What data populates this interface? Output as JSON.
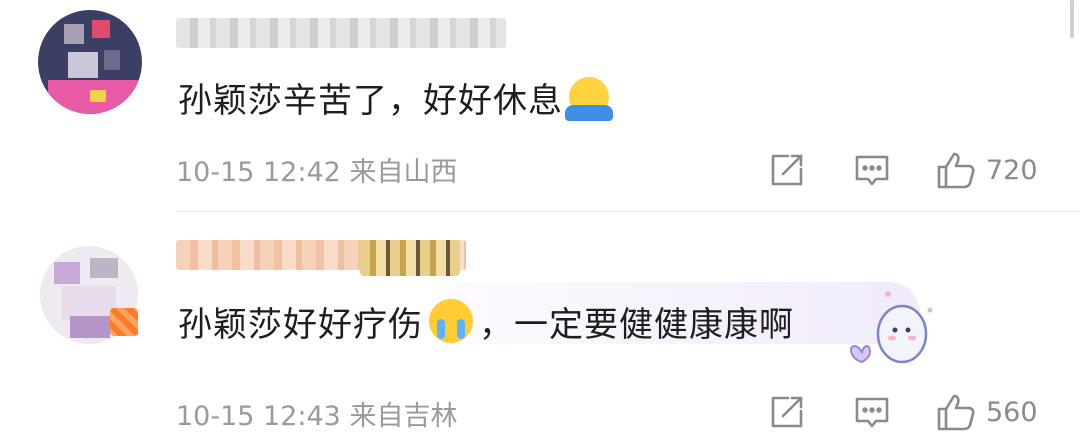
{
  "comments": [
    {
      "content": "孙颖莎辛苦了，好好休息",
      "emoji": "shrug-emoji",
      "time": "10-15 12:42",
      "location": "来自山西",
      "likes": "720"
    },
    {
      "content_before": "孙颖莎好好疗伤",
      "emoji": "loudly-crying-emoji",
      "content_after": "，一定要健健康康啊",
      "time": "10-15 12:43",
      "location": "来自吉林",
      "likes": "560"
    }
  ],
  "icons": {
    "share": "share-icon",
    "reply": "reply-comment-icon",
    "like": "thumbs-up-icon"
  },
  "colors": {
    "text": "#1e1e1e",
    "meta": "#9a9a9a",
    "icon": "#8a8a8a",
    "divider": "#ececec"
  }
}
